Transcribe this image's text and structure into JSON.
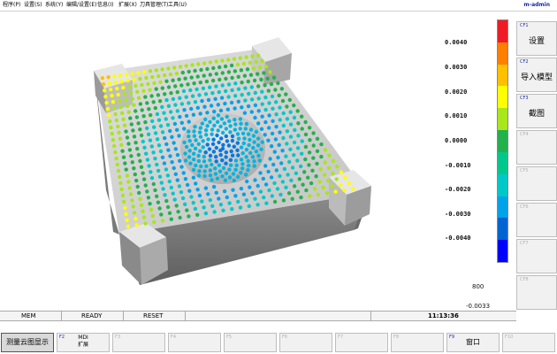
{
  "menu": {
    "items": [
      "程序(P)",
      "设置(S)",
      "系统(Y)",
      "编辑/设置(E)",
      "信息(I)",
      "扩展(X)",
      "刀具管理(T)",
      "工具(U)"
    ],
    "user": "m-admin"
  },
  "scale": {
    "ticks": [
      "0.0040",
      "0.0030",
      "0.0020",
      "0.0010",
      "0.0000",
      "-0.0010",
      "-0.0020",
      "-0.0030",
      "-0.0040"
    ],
    "count_label": "800",
    "min_value": "-0.0033",
    "colors": [
      "#ee1c24",
      "#ff7f00",
      "#ffc000",
      "#ffff00",
      "#a8e61d",
      "#22b14c",
      "#00c88c",
      "#00c8c8",
      "#00a2e8",
      "#0064d2",
      "#0000ff"
    ]
  },
  "right_softkeys": [
    {
      "key": "CF1",
      "label": "设置",
      "enabled": true
    },
    {
      "key": "CF2",
      "label": "导入模型",
      "enabled": true
    },
    {
      "key": "CF3",
      "label": "截图",
      "enabled": true
    },
    {
      "key": "CF4",
      "label": "",
      "enabled": false
    },
    {
      "key": "CF5",
      "label": "",
      "enabled": false
    },
    {
      "key": "CF6",
      "label": "",
      "enabled": false
    },
    {
      "key": "CF7",
      "label": "",
      "enabled": false
    },
    {
      "key": "CF8",
      "label": "",
      "enabled": false
    }
  ],
  "status": {
    "mode": "MEM",
    "state": "READY",
    "reset": "RESET",
    "time": "11:13:36"
  },
  "bottom_softkeys": [
    {
      "key": "",
      "label": "测量云图显示",
      "active": true,
      "enabled": true
    },
    {
      "key": "F2",
      "label": "MDI",
      "label2": "扩展",
      "active": false,
      "enabled": true
    },
    {
      "key": "F3",
      "label": "",
      "active": false,
      "enabled": false
    },
    {
      "key": "F4",
      "label": "",
      "active": false,
      "enabled": false
    },
    {
      "key": "F5",
      "label": "",
      "active": false,
      "enabled": false
    },
    {
      "key": "F6",
      "label": "",
      "active": false,
      "enabled": false
    },
    {
      "key": "F7",
      "label": "",
      "active": false,
      "enabled": false
    },
    {
      "key": "F8",
      "label": "",
      "active": false,
      "enabled": false
    },
    {
      "key": "F9",
      "label": "窗口",
      "active": false,
      "enabled": true
    },
    {
      "key": "F10",
      "label": "",
      "active": false,
      "enabled": false
    }
  ]
}
